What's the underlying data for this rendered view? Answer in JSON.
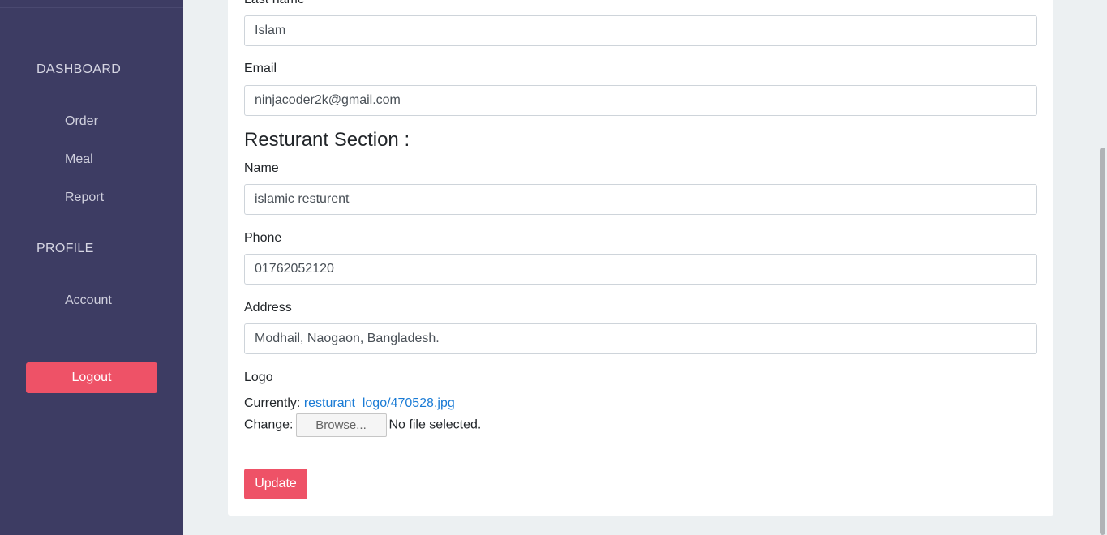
{
  "sidebar": {
    "sections": [
      {
        "label": "DASHBOARD"
      },
      {
        "label": "PROFILE"
      }
    ],
    "items": [
      {
        "label": "Order"
      },
      {
        "label": "Meal"
      },
      {
        "label": "Report"
      },
      {
        "label": "Account"
      }
    ],
    "logout_label": "Logout"
  },
  "form": {
    "last_name": {
      "label": "Last name",
      "value": "Islam"
    },
    "email": {
      "label": "Email",
      "value": "ninjacoder2k@gmail.com"
    },
    "restaurant_section_title": "Resturant Section :",
    "name": {
      "label": "Name",
      "value": "islamic resturent"
    },
    "phone": {
      "label": "Phone",
      "value": "01762052120"
    },
    "address": {
      "label": "Address",
      "value": "Modhail, Naogaon, Bangladesh."
    },
    "logo": {
      "label": "Logo",
      "currently_label": "Currently:",
      "current_file": "resturant_logo/470528.jpg",
      "change_label": "Change:",
      "browse_label": "Browse...",
      "no_file_text": "No file selected."
    },
    "update_label": "Update"
  },
  "colors": {
    "sidebar_bg": "#3d3c63",
    "accent": "#ee5267",
    "link": "#1a7bd5",
    "page_bg": "#ecf0f2"
  }
}
